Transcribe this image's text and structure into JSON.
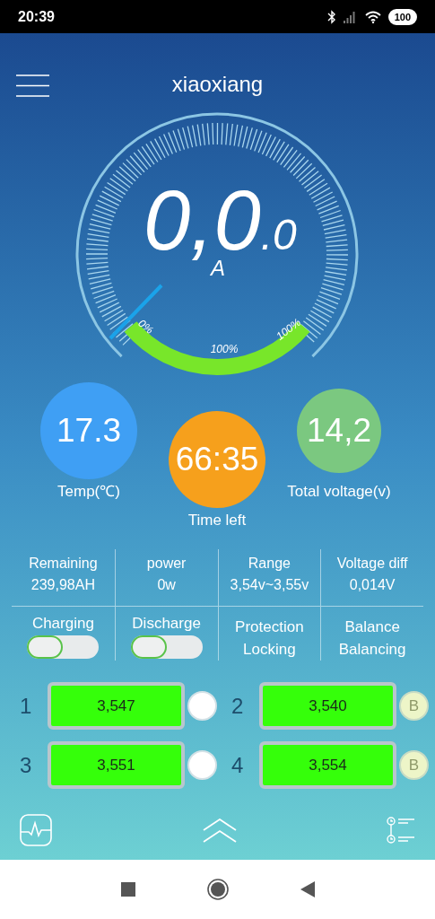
{
  "status_bar": {
    "time": "20:39",
    "battery": "100"
  },
  "header": {
    "title": "xiaoxiang"
  },
  "gauge": {
    "current_main": "0,0",
    "current_decimal": ".0",
    "unit": "A",
    "scale_labels": [
      "0%",
      "100%",
      "100%"
    ]
  },
  "readings": [
    {
      "value": "17.3",
      "label": "Temp(℃)",
      "color": "#3f9ff4"
    },
    {
      "value": "66:35",
      "label": "Time left",
      "color": "#f6a01c"
    },
    {
      "value": "14,2",
      "label": "Total voltage(v)",
      "color": "#7bc880"
    }
  ],
  "stats": [
    {
      "label": "Remaining",
      "value": "239,98AH"
    },
    {
      "label": "power",
      "value": "0w"
    },
    {
      "label": "Range",
      "value": "3,54v~3,55v"
    },
    {
      "label": "Voltage diff",
      "value": "0,014V"
    }
  ],
  "states": [
    {
      "kind": "switch",
      "label": "Charging",
      "on": false
    },
    {
      "kind": "switch",
      "label": "Discharge",
      "on": false
    },
    {
      "kind": "text",
      "label": "Protection",
      "value": "Locking"
    },
    {
      "kind": "text",
      "label": "Balance",
      "value": "Balancing"
    }
  ],
  "cells": [
    {
      "index": "1",
      "voltage": "3,547",
      "balancing": false
    },
    {
      "index": "2",
      "voltage": "3,540",
      "balancing": true,
      "badge": "B"
    },
    {
      "index": "3",
      "voltage": "3,551",
      "balancing": false
    },
    {
      "index": "4",
      "voltage": "3,554",
      "balancing": true,
      "badge": "B"
    }
  ]
}
